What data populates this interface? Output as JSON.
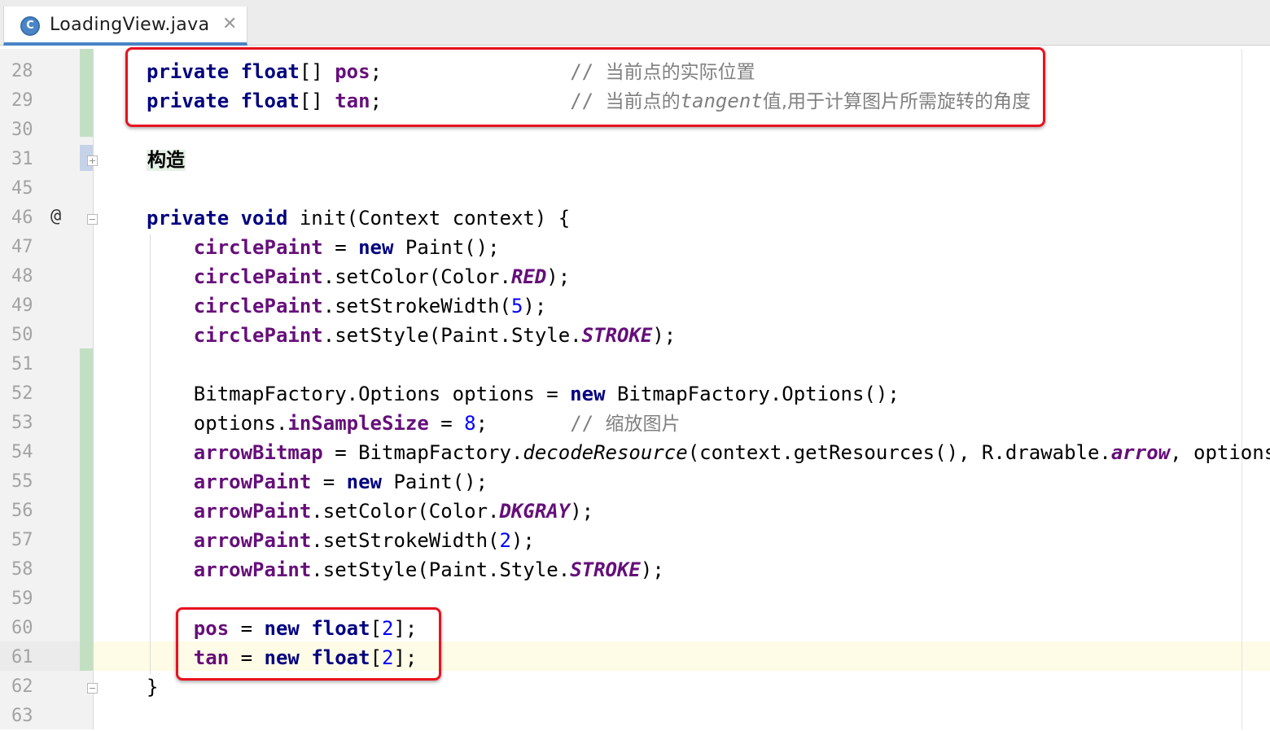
{
  "tab": {
    "icon_letter": "C",
    "title": "LoadingView.java",
    "close_glyph": "✕"
  },
  "override_marker": "@",
  "lines": [
    {
      "no": "28",
      "code": [
        {
          "t": "private",
          "c": "kw"
        },
        {
          "t": " "
        },
        {
          "t": "float",
          "c": "kw"
        },
        {
          "t": "[] "
        },
        {
          "t": "pos",
          "c": "fld"
        },
        {
          "t": ";                "
        },
        {
          "t": "// ",
          "c": "cmt"
        },
        {
          "t": "当前点的实际位置",
          "c": "cmt-zh"
        }
      ]
    },
    {
      "no": "29",
      "code": [
        {
          "t": "private",
          "c": "kw"
        },
        {
          "t": " "
        },
        {
          "t": "float",
          "c": "kw"
        },
        {
          "t": "[] "
        },
        {
          "t": "tan",
          "c": "fld"
        },
        {
          "t": ";                "
        },
        {
          "t": "// ",
          "c": "cmt"
        },
        {
          "t": "当前点的",
          "c": "cmt-zh"
        },
        {
          "t": "tangent",
          "c": "cmt-it"
        },
        {
          "t": "值,用于计算图片所需旋转的角度",
          "c": "cmt-zh"
        }
      ]
    },
    {
      "no": "30",
      "code": []
    },
    {
      "no": "31",
      "code": [
        {
          "t": "构造",
          "c": "folded"
        }
      ]
    },
    {
      "no": "45",
      "code": []
    },
    {
      "no": "46",
      "code": [
        {
          "t": "private",
          "c": "kw"
        },
        {
          "t": " "
        },
        {
          "t": "void",
          "c": "kw"
        },
        {
          "t": " init(Context context) {"
        }
      ]
    },
    {
      "no": "47",
      "code": [
        {
          "t": "    "
        },
        {
          "t": "circlePaint",
          "c": "fld"
        },
        {
          "t": " = "
        },
        {
          "t": "new",
          "c": "kw"
        },
        {
          "t": " Paint();"
        }
      ]
    },
    {
      "no": "48",
      "code": [
        {
          "t": "    "
        },
        {
          "t": "circlePaint",
          "c": "fld"
        },
        {
          "t": ".setColor(Color."
        },
        {
          "t": "RED",
          "c": "const"
        },
        {
          "t": ");"
        }
      ]
    },
    {
      "no": "49",
      "code": [
        {
          "t": "    "
        },
        {
          "t": "circlePaint",
          "c": "fld"
        },
        {
          "t": ".setStrokeWidth("
        },
        {
          "t": "5",
          "c": "num"
        },
        {
          "t": ");"
        }
      ]
    },
    {
      "no": "50",
      "code": [
        {
          "t": "    "
        },
        {
          "t": "circlePaint",
          "c": "fld"
        },
        {
          "t": ".setStyle(Paint.Style."
        },
        {
          "t": "STROKE",
          "c": "const"
        },
        {
          "t": ");"
        }
      ]
    },
    {
      "no": "51",
      "code": []
    },
    {
      "no": "52",
      "code": [
        {
          "t": "    BitmapFactory.Options options = "
        },
        {
          "t": "new",
          "c": "kw"
        },
        {
          "t": " BitmapFactory.Options();"
        }
      ]
    },
    {
      "no": "53",
      "code": [
        {
          "t": "    options."
        },
        {
          "t": "inSampleSize",
          "c": "fld"
        },
        {
          "t": " = "
        },
        {
          "t": "8",
          "c": "num"
        },
        {
          "t": ";       "
        },
        {
          "t": "// ",
          "c": "cmt"
        },
        {
          "t": "缩放图片",
          "c": "cmt-zh"
        }
      ]
    },
    {
      "no": "54",
      "code": [
        {
          "t": "    "
        },
        {
          "t": "arrowBitmap",
          "c": "fld"
        },
        {
          "t": " = BitmapFactory."
        },
        {
          "t": "decodeResource",
          "c": "mth-it"
        },
        {
          "t": "(context.getResources(), R.drawable."
        },
        {
          "t": "arrow",
          "c": "const"
        },
        {
          "t": ", options);"
        }
      ]
    },
    {
      "no": "55",
      "code": [
        {
          "t": "    "
        },
        {
          "t": "arrowPaint",
          "c": "fld"
        },
        {
          "t": " = "
        },
        {
          "t": "new",
          "c": "kw"
        },
        {
          "t": " Paint();"
        }
      ]
    },
    {
      "no": "56",
      "code": [
        {
          "t": "    "
        },
        {
          "t": "arrowPaint",
          "c": "fld"
        },
        {
          "t": ".setColor(Color."
        },
        {
          "t": "DKGRAY",
          "c": "const"
        },
        {
          "t": ");"
        }
      ]
    },
    {
      "no": "57",
      "code": [
        {
          "t": "    "
        },
        {
          "t": "arrowPaint",
          "c": "fld"
        },
        {
          "t": ".setStrokeWidth("
        },
        {
          "t": "2",
          "c": "num"
        },
        {
          "t": ");"
        }
      ]
    },
    {
      "no": "58",
      "code": [
        {
          "t": "    "
        },
        {
          "t": "arrowPaint",
          "c": "fld"
        },
        {
          "t": ".setStyle(Paint.Style."
        },
        {
          "t": "STROKE",
          "c": "const"
        },
        {
          "t": ");"
        }
      ]
    },
    {
      "no": "59",
      "code": []
    },
    {
      "no": "60",
      "code": [
        {
          "t": "    "
        },
        {
          "t": "pos",
          "c": "fld"
        },
        {
          "t": " = "
        },
        {
          "t": "new",
          "c": "kw"
        },
        {
          "t": " "
        },
        {
          "t": "float",
          "c": "kw"
        },
        {
          "t": "["
        },
        {
          "t": "2",
          "c": "num"
        },
        {
          "t": "];"
        }
      ]
    },
    {
      "no": "61",
      "code": [
        {
          "t": "    "
        },
        {
          "t": "tan",
          "c": "fld"
        },
        {
          "t": " = "
        },
        {
          "t": "new",
          "c": "kw"
        },
        {
          "t": " "
        },
        {
          "t": "float",
          "c": "kw"
        },
        {
          "t": "["
        },
        {
          "t": "2",
          "c": "num"
        },
        {
          "t": "];"
        }
      ]
    },
    {
      "no": "62",
      "code": [
        {
          "t": "}"
        }
      ]
    },
    {
      "no": "63",
      "code": []
    }
  ],
  "colors": {
    "keyword": "#000080",
    "field": "#660e7a",
    "number": "#0000ff",
    "comment": "#808080",
    "highlight_box": "#e8121f",
    "change_bar": "#c3dfc2",
    "current_line": "#fefbe6"
  }
}
